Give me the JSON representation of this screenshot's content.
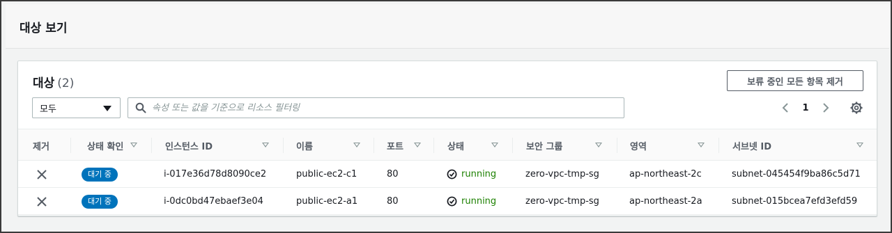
{
  "header": {
    "title": "대상 보기"
  },
  "panel": {
    "title": "대상",
    "count": "(2)",
    "remove_all_label": "보류 중인 모든 항목 제거"
  },
  "filter": {
    "selected": "모두",
    "search_placeholder": "속성 또는 값을 기준으로 리소스 필터링"
  },
  "pagination": {
    "current_page": "1"
  },
  "table": {
    "columns": [
      "제거",
      "상태 확인",
      "인스턴스 ID",
      "이름",
      "포트",
      "상태",
      "보안 그룹",
      "영역",
      "서브넷 ID"
    ],
    "rows": [
      {
        "health": "대기 중",
        "instance_id": "i-017e36d78d8090ce2",
        "name": "public-ec2-c1",
        "port": "80",
        "state": "running",
        "security_group": "zero-vpc-tmp-sg",
        "zone": "ap-northeast-2c",
        "subnet": "subnet-045454f9ba86c5d71"
      },
      {
        "health": "대기 중",
        "instance_id": "i-0dc0bd47ebaef3e04",
        "name": "public-ec2-a1",
        "port": "80",
        "state": "running",
        "security_group": "zero-vpc-tmp-sg",
        "zone": "ap-northeast-2a",
        "subnet": "subnet-015bcea7efd3efd59"
      }
    ]
  },
  "colors": {
    "badge_blue": "#0073bb",
    "running_green": "#1d8102",
    "border": "#d5dbdb"
  }
}
